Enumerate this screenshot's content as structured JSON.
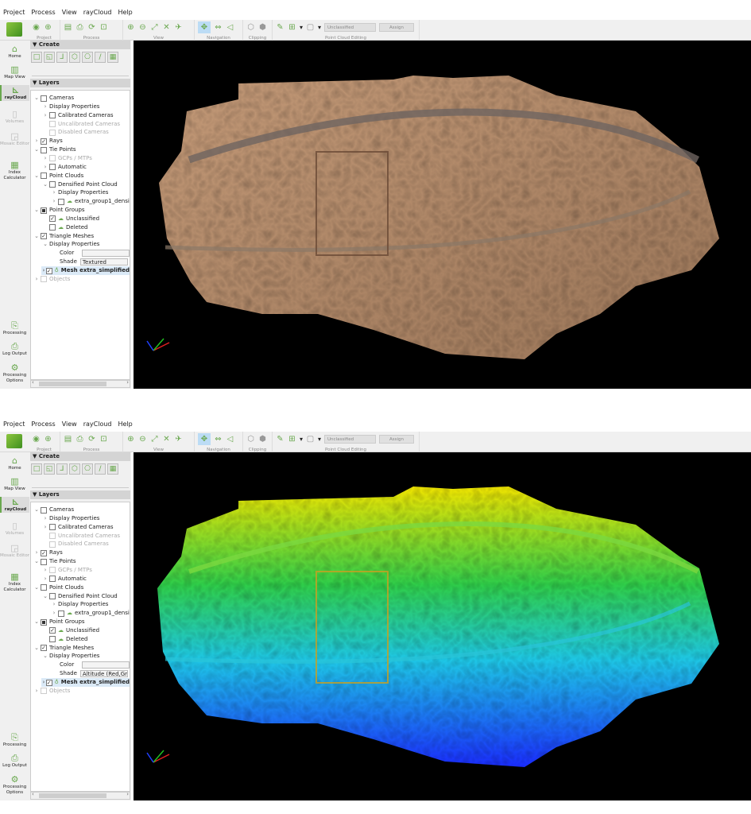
{
  "menu": [
    "Project",
    "Process",
    "View",
    "rayCloud",
    "Help"
  ],
  "toolbar": {
    "groups": [
      {
        "label": "Project",
        "icons": [
          "open-project-icon",
          "crosshair-icon"
        ]
      },
      {
        "label": "Process",
        "icons": [
          "report-icon",
          "export-icon",
          "refresh-icon",
          "process-icon"
        ]
      },
      {
        "label": "View",
        "icons": [
          "zoom-in-icon",
          "zoom-out-icon",
          "fit-icon",
          "zoom-all-icon",
          "fly-icon"
        ]
      },
      {
        "label": "Navigation",
        "icons": [
          "trackball-icon",
          "first-person-icon",
          "view-frustum-icon"
        ]
      },
      {
        "label": "Clipping",
        "icons": [
          "clip-box-icon",
          "clip-settings-icon"
        ]
      },
      {
        "label": "Point Cloud Editing",
        "icons": [
          "brush-icon",
          "add-icon"
        ]
      }
    ],
    "class_select": "Unclassified",
    "assign_label": "Assign"
  },
  "rail": [
    {
      "label": "Home",
      "icon": "⌂",
      "state": "normal"
    },
    {
      "label": "Map View",
      "icon": "▥",
      "state": "normal"
    },
    {
      "label": "rayCloud",
      "icon": "⊾",
      "state": "selected"
    },
    {
      "label": "Volumes",
      "icon": "▯",
      "state": "disabled"
    },
    {
      "label": "Mosaic Editor",
      "icon": "◲",
      "state": "disabled"
    },
    {
      "label": "Index Calculator",
      "icon": "▦",
      "state": "normal"
    },
    {
      "label": "Processing",
      "icon": "⎘",
      "state": "normal"
    },
    {
      "label": "Log Output",
      "icon": "⎙",
      "state": "normal"
    },
    {
      "label": "Processing Options",
      "icon": "⚙",
      "state": "normal"
    }
  ],
  "side": {
    "create_label": "Create",
    "layers_label": "Layers"
  },
  "panels": [
    {
      "shade": "Textured",
      "view": "textured"
    },
    {
      "shade": "Altitude (Red,Green",
      "view": "altitude"
    }
  ],
  "layers": [
    {
      "label": "Cameras",
      "lvl": 0,
      "chev": "v",
      "cb": "empty"
    },
    {
      "label": "Display Properties",
      "lvl": 1,
      "chev": ">",
      "cb": "none"
    },
    {
      "label": "Calibrated Cameras",
      "lvl": 1,
      "chev": ">",
      "cb": "empty"
    },
    {
      "label": "Uncalibrated Cameras",
      "lvl": 1,
      "chev": "",
      "cb": "grey",
      "grey": true
    },
    {
      "label": "Disabled Cameras",
      "lvl": 1,
      "chev": "",
      "cb": "grey",
      "grey": true
    },
    {
      "label": "Rays",
      "lvl": 0,
      "chev": ">",
      "cb": "checked"
    },
    {
      "label": "Tie Points",
      "lvl": 0,
      "chev": "v",
      "cb": "empty"
    },
    {
      "label": "GCPs / MTPs",
      "lvl": 1,
      "chev": ">",
      "cb": "grey",
      "grey": true
    },
    {
      "label": "Automatic",
      "lvl": 1,
      "chev": ">",
      "cb": "empty"
    },
    {
      "label": "Point Clouds",
      "lvl": 0,
      "chev": "v",
      "cb": "empty"
    },
    {
      "label": "Densified Point Cloud",
      "lvl": 1,
      "chev": "v",
      "cb": "empty"
    },
    {
      "label": "Display Properties",
      "lvl": 2,
      "chev": ">",
      "cb": "none"
    },
    {
      "label": "extra_group1_densi",
      "lvl": 2,
      "chev": ">",
      "cb": "empty",
      "icon": "cloud"
    },
    {
      "label": "Point Groups",
      "lvl": 0,
      "chev": "v",
      "cb": "partial"
    },
    {
      "label": "Unclassified",
      "lvl": 1,
      "chev": "",
      "cb": "checked",
      "icon": "cloud"
    },
    {
      "label": "Deleted",
      "lvl": 1,
      "chev": "",
      "cb": "empty",
      "icon": "cloud"
    },
    {
      "label": "Triangle Meshes",
      "lvl": 0,
      "chev": "v",
      "cb": "checked"
    },
    {
      "label": "Display Properties",
      "lvl": 1,
      "chev": "v",
      "cb": "none"
    },
    {
      "label": "Color",
      "lvl": 3,
      "chev": "",
      "cb": "none",
      "field": "color"
    },
    {
      "label": "Shade",
      "lvl": 3,
      "chev": "",
      "cb": "none",
      "field": "shade"
    },
    {
      "label": "Mesh extra_simplified",
      "lvl": 1,
      "chev": ">",
      "cb": "checked",
      "icon": "mesh",
      "selected": true
    },
    {
      "label": "Objects",
      "lvl": 0,
      "chev": ">",
      "cb": "grey",
      "grey": true
    }
  ],
  "colors": {
    "accent": "#6aa84f",
    "sand": "#b08868",
    "alt_top": "#f2e600",
    "alt_mid": "#2fd04a",
    "alt_low": "#1ec8e8",
    "alt_bottom": "#1a2cff"
  }
}
